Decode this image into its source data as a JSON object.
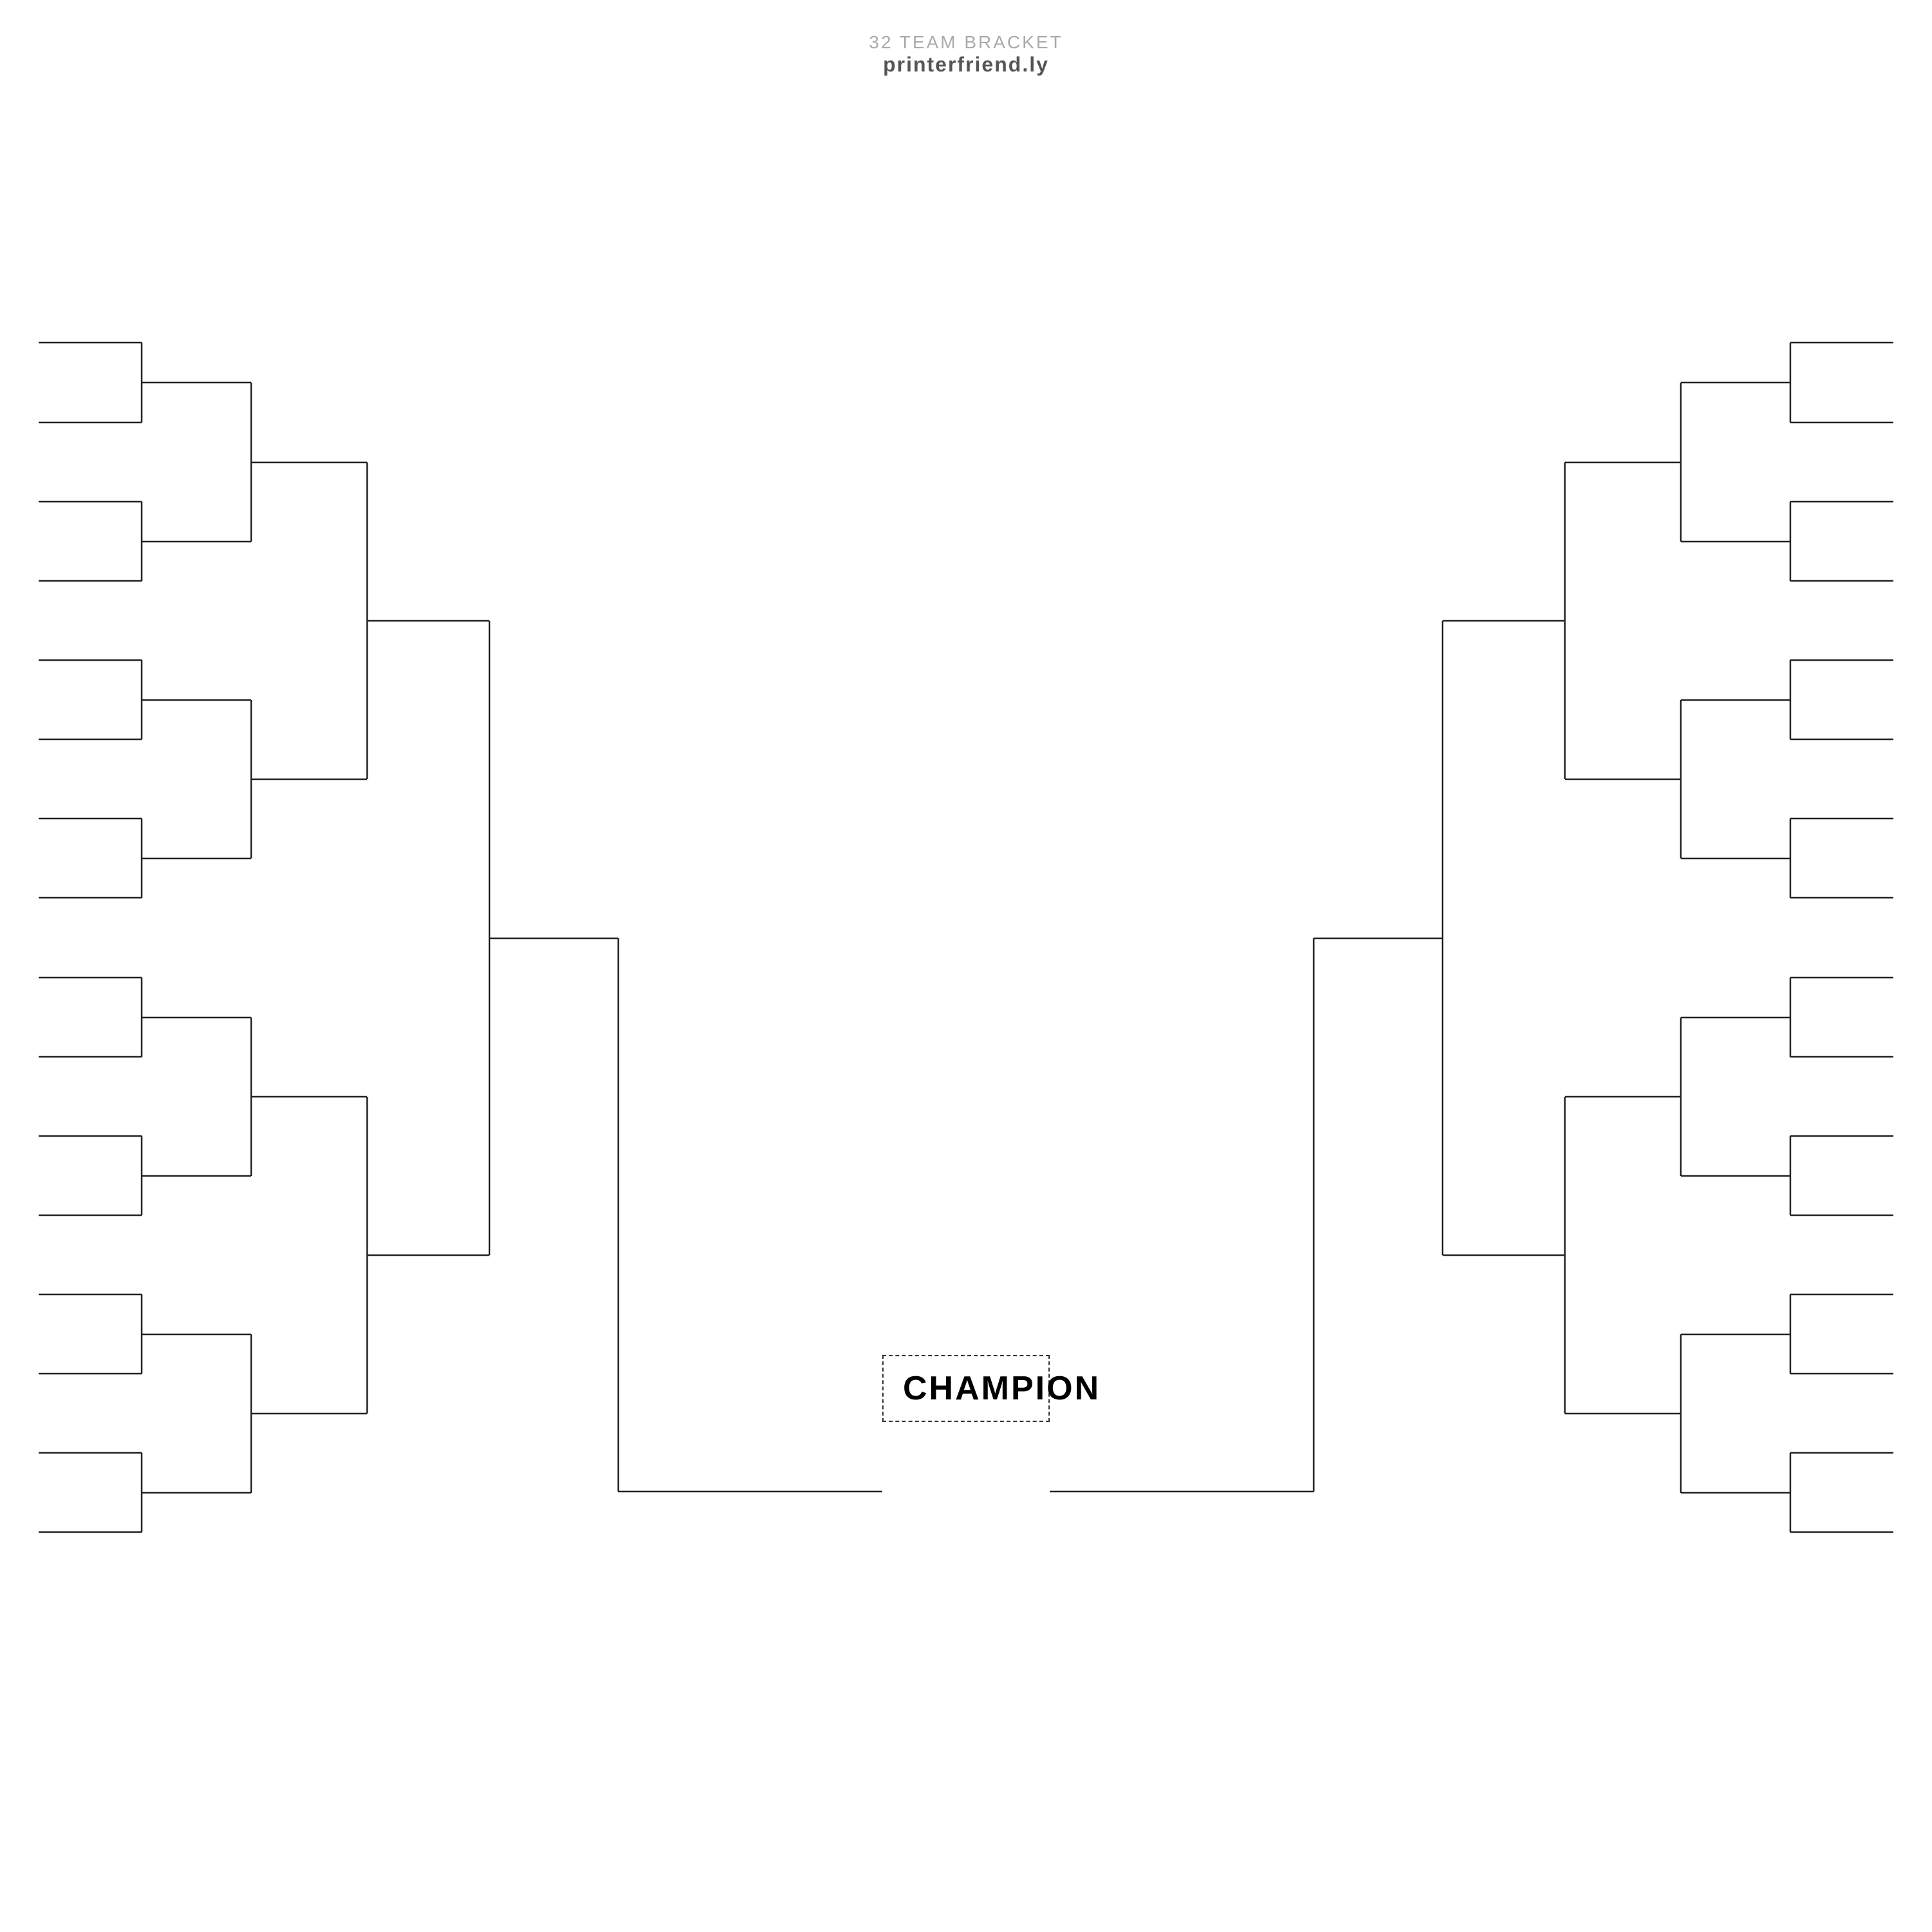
{
  "header": {
    "title": "32 TEAM BRACKET",
    "subtitle": "printerfriend.ly"
  },
  "champion": {
    "label": "CHAMPION"
  }
}
